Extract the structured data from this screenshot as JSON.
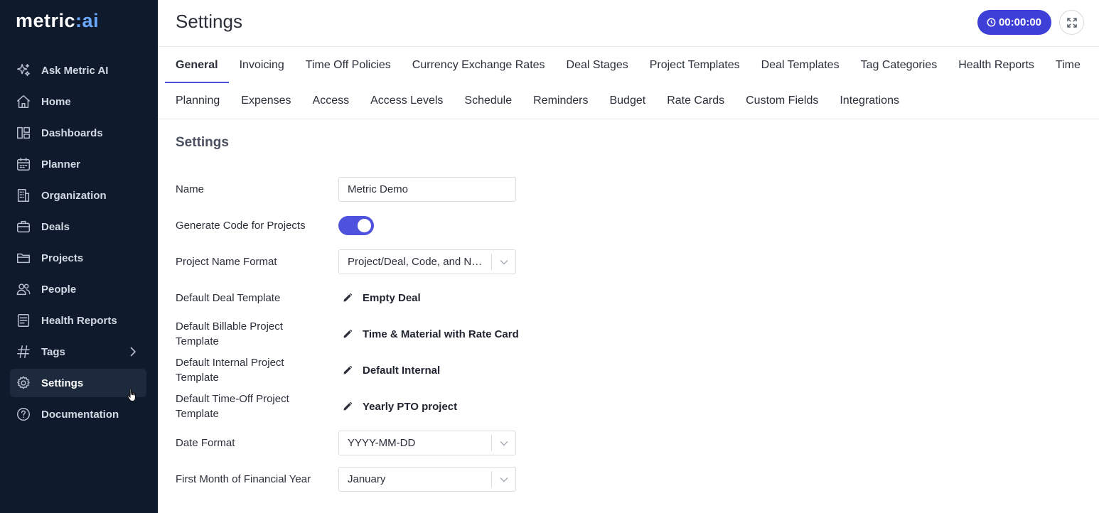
{
  "brand": {
    "logo_main": "metric",
    "logo_sep": ":",
    "logo_ai": "ai"
  },
  "sidebar": {
    "items": [
      {
        "label": "Ask Metric AI",
        "icon": "sparkle-icon"
      },
      {
        "label": "Home",
        "icon": "home-icon"
      },
      {
        "label": "Dashboards",
        "icon": "dashboard-icon"
      },
      {
        "label": "Planner",
        "icon": "calendar-icon"
      },
      {
        "label": "Organization",
        "icon": "building-icon"
      },
      {
        "label": "Deals",
        "icon": "briefcase-icon"
      },
      {
        "label": "Projects",
        "icon": "folder-icon"
      },
      {
        "label": "People",
        "icon": "people-icon"
      },
      {
        "label": "Health Reports",
        "icon": "report-icon"
      },
      {
        "label": "Tags",
        "icon": "hash-icon"
      },
      {
        "label": "Settings",
        "icon": "gear-icon"
      },
      {
        "label": "Documentation",
        "icon": "help-icon"
      }
    ]
  },
  "header": {
    "title": "Settings",
    "timer": "00:00:00"
  },
  "tabs": {
    "row1": [
      "General",
      "Invoicing",
      "Time Off Policies",
      "Currency Exchange Rates",
      "Deal Stages",
      "Project Templates",
      "Deal Templates",
      "Tag Categories",
      "Health Reports",
      "Time"
    ],
    "row2": [
      "Planning",
      "Expenses",
      "Access",
      "Access Levels",
      "Schedule",
      "Reminders",
      "Budget",
      "Rate Cards",
      "Custom Fields",
      "Integrations"
    ],
    "active": "General"
  },
  "settings": {
    "section_title": "Settings",
    "name_label": "Name",
    "name_value": "Metric Demo",
    "gen_code_label": "Generate Code for Projects",
    "gen_code_on": true,
    "name_format_label": "Project Name Format",
    "name_format_value": "Project/Deal, Code, and Name",
    "deal_tpl_label": "Default Deal Template",
    "deal_tpl_value": "Empty Deal",
    "billable_tpl_label": "Default Billable Project Template",
    "billable_tpl_value": "Time & Material with Rate Card",
    "internal_tpl_label": "Default Internal Project Template",
    "internal_tpl_value": "Default Internal",
    "timeoff_tpl_label": "Default Time-Off Project Template",
    "timeoff_tpl_value": "Yearly PTO project",
    "date_format_label": "Date Format",
    "date_format_value": "YYYY-MM-DD",
    "fin_month_label": "First Month of Financial Year",
    "fin_month_value": "January"
  }
}
